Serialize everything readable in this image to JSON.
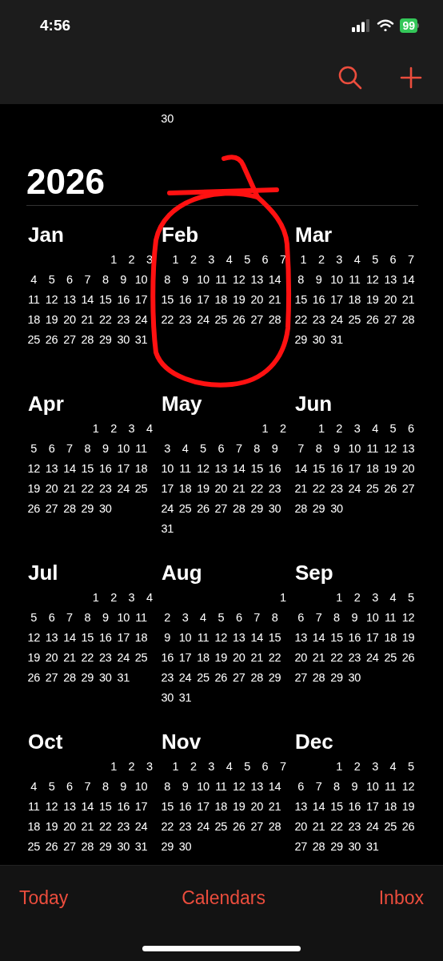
{
  "status_bar": {
    "time": "4:56",
    "battery": "99"
  },
  "toolbar": {
    "buttons": [
      {
        "kind": "search"
      },
      {
        "kind": "add"
      }
    ]
  },
  "previous_year_tail": {
    "day": "30"
  },
  "year": "2026",
  "months": [
    {
      "name": "Jan",
      "weeks": [
        [
          "1",
          "2",
          "3"
        ],
        [
          "4",
          "5",
          "6",
          "7",
          "8",
          "9",
          "10"
        ],
        [
          "11",
          "12",
          "13",
          "14",
          "15",
          "16",
          "17"
        ],
        [
          "18",
          "19",
          "20",
          "21",
          "22",
          "23",
          "24"
        ],
        [
          "25",
          "26",
          "27",
          "28",
          "29",
          "30",
          "31"
        ]
      ]
    },
    {
      "name": "Feb",
      "weeks": [
        [
          "1",
          "2",
          "3",
          "4",
          "5",
          "6",
          "7"
        ],
        [
          "8",
          "9",
          "10",
          "11",
          "12",
          "13",
          "14"
        ],
        [
          "15",
          "16",
          "17",
          "18",
          "19",
          "20",
          "21"
        ],
        [
          "22",
          "23",
          "24",
          "25",
          "26",
          "27",
          "28"
        ]
      ]
    },
    {
      "name": "Mar",
      "weeks": [
        [
          "1",
          "2",
          "3",
          "4",
          "5",
          "6",
          "7"
        ],
        [
          "8",
          "9",
          "10",
          "11",
          "12",
          "13",
          "14"
        ],
        [
          "15",
          "16",
          "17",
          "18",
          "19",
          "20",
          "21"
        ],
        [
          "22",
          "23",
          "24",
          "25",
          "26",
          "27",
          "28"
        ],
        [
          "29",
          "30",
          "31"
        ]
      ]
    },
    {
      "name": "Apr",
      "weeks": [
        [
          "1",
          "2",
          "3",
          "4"
        ],
        [
          "5",
          "6",
          "7",
          "8",
          "9",
          "10",
          "11"
        ],
        [
          "12",
          "13",
          "14",
          "15",
          "16",
          "17",
          "18"
        ],
        [
          "19",
          "20",
          "21",
          "22",
          "23",
          "24",
          "25"
        ],
        [
          "26",
          "27",
          "28",
          "29",
          "30"
        ]
      ]
    },
    {
      "name": "May",
      "weeks": [
        [
          "1",
          "2"
        ],
        [
          "3",
          "4",
          "5",
          "6",
          "7",
          "8",
          "9"
        ],
        [
          "10",
          "11",
          "12",
          "13",
          "14",
          "15",
          "16"
        ],
        [
          "17",
          "18",
          "19",
          "20",
          "21",
          "22",
          "23"
        ],
        [
          "24",
          "25",
          "26",
          "27",
          "28",
          "29",
          "30"
        ],
        [
          "31"
        ]
      ]
    },
    {
      "name": "Jun",
      "weeks": [
        [
          "1",
          "2",
          "3",
          "4",
          "5",
          "6"
        ],
        [
          "7",
          "8",
          "9",
          "10",
          "11",
          "12",
          "13"
        ],
        [
          "14",
          "15",
          "16",
          "17",
          "18",
          "19",
          "20"
        ],
        [
          "21",
          "22",
          "23",
          "24",
          "25",
          "26",
          "27"
        ],
        [
          "28",
          "29",
          "30"
        ]
      ]
    },
    {
      "name": "Jul",
      "weeks": [
        [
          "1",
          "2",
          "3",
          "4"
        ],
        [
          "5",
          "6",
          "7",
          "8",
          "9",
          "10",
          "11"
        ],
        [
          "12",
          "13",
          "14",
          "15",
          "16",
          "17",
          "18"
        ],
        [
          "19",
          "20",
          "21",
          "22",
          "23",
          "24",
          "25"
        ],
        [
          "26",
          "27",
          "28",
          "29",
          "30",
          "31"
        ]
      ]
    },
    {
      "name": "Aug",
      "weeks": [
        [
          "1"
        ],
        [
          "2",
          "3",
          "4",
          "5",
          "6",
          "7",
          "8"
        ],
        [
          "9",
          "10",
          "11",
          "12",
          "13",
          "14",
          "15"
        ],
        [
          "16",
          "17",
          "18",
          "19",
          "20",
          "21",
          "22"
        ],
        [
          "23",
          "24",
          "25",
          "26",
          "27",
          "28",
          "29"
        ],
        [
          "30",
          "31"
        ]
      ]
    },
    {
      "name": "Sep",
      "weeks": [
        [
          "1",
          "2",
          "3",
          "4",
          "5"
        ],
        [
          "6",
          "7",
          "8",
          "9",
          "10",
          "11",
          "12"
        ],
        [
          "13",
          "14",
          "15",
          "16",
          "17",
          "18",
          "19"
        ],
        [
          "20",
          "21",
          "22",
          "23",
          "24",
          "25",
          "26"
        ],
        [
          "27",
          "28",
          "29",
          "30"
        ]
      ]
    },
    {
      "name": "Oct",
      "weeks": [
        [
          "1",
          "2",
          "3"
        ],
        [
          "4",
          "5",
          "6",
          "7",
          "8",
          "9",
          "10"
        ],
        [
          "11",
          "12",
          "13",
          "14",
          "15",
          "16",
          "17"
        ],
        [
          "18",
          "19",
          "20",
          "21",
          "22",
          "23",
          "24"
        ],
        [
          "25",
          "26",
          "27",
          "28",
          "29",
          "30",
          "31"
        ]
      ]
    },
    {
      "name": "Nov",
      "weeks": [
        [
          "1",
          "2",
          "3",
          "4",
          "5",
          "6",
          "7"
        ],
        [
          "8",
          "9",
          "10",
          "11",
          "12",
          "13",
          "14"
        ],
        [
          "15",
          "16",
          "17",
          "18",
          "19",
          "20",
          "21"
        ],
        [
          "22",
          "23",
          "24",
          "25",
          "26",
          "27",
          "28"
        ],
        [
          "29",
          "30"
        ]
      ]
    },
    {
      "name": "Dec",
      "weeks": [
        [
          "1",
          "2",
          "3",
          "4",
          "5"
        ],
        [
          "6",
          "7",
          "8",
          "9",
          "10",
          "11",
          "12"
        ],
        [
          "13",
          "14",
          "15",
          "16",
          "17",
          "18",
          "19"
        ],
        [
          "20",
          "21",
          "22",
          "23",
          "24",
          "25",
          "26"
        ],
        [
          "27",
          "28",
          "29",
          "30",
          "31"
        ]
      ]
    }
  ],
  "annotation": {
    "kind": "scribble",
    "color": "#ff1111"
  },
  "tab_bar": [
    "Today",
    "Calendars",
    "Inbox"
  ]
}
